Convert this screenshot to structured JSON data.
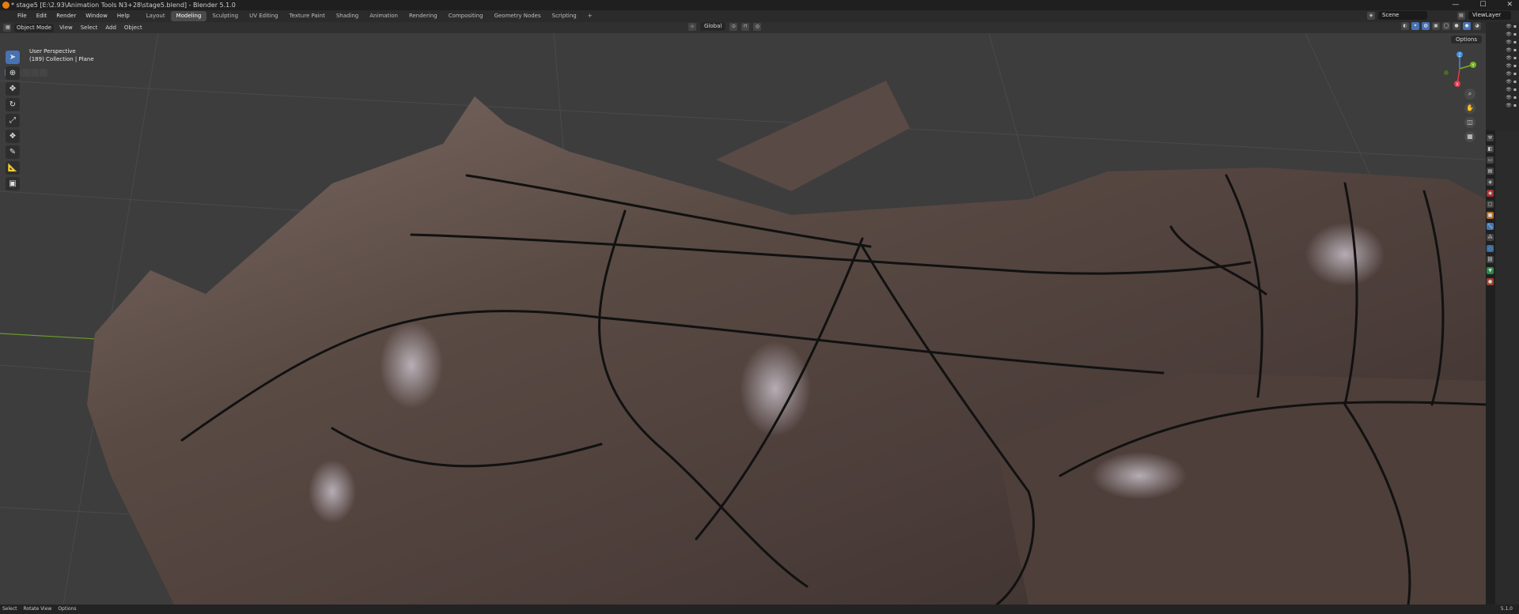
{
  "window": {
    "title": "* stage5 [E:\\2.93\\Animation Tools N3+28\\stage5.blend] - Blender 5.1.0",
    "minimize": "—",
    "maximize": "☐",
    "close": "✕"
  },
  "menu": [
    "File",
    "Edit",
    "Render",
    "Window",
    "Help"
  ],
  "workspaces": [
    "Layout",
    "Modeling",
    "Sculpting",
    "UV Editing",
    "Texture Paint",
    "Shading",
    "Animation",
    "Rendering",
    "Compositing",
    "Geometry Nodes",
    "Scripting"
  ],
  "active_workspace": "Modeling",
  "add_workspace": "+",
  "scene": {
    "name": "Scene",
    "view_layer": "ViewLayer"
  },
  "viewport_header": {
    "mode": "Object Mode",
    "menus": [
      "View",
      "Select",
      "Add",
      "Object"
    ],
    "transform_orientation": "Global",
    "options_label": "Options"
  },
  "overlay": {
    "perspective": "User Perspective",
    "collection": "(189) Collection | Plane"
  },
  "gizmo": {
    "x": "X",
    "y": "Y",
    "z": "Z"
  },
  "tools": [
    "select-box",
    "cursor",
    "move",
    "rotate",
    "scale",
    "transform",
    "annotate",
    "measure",
    "add-cube"
  ],
  "status": {
    "select": "Select",
    "rotate": "Rotate View",
    "options": "Options",
    "version": "5.1.0"
  },
  "colors": {
    "accent": "#4772b3",
    "x_axis": "#e5394b",
    "y_axis": "#77b023",
    "z_axis": "#3b8ee0",
    "logo": "#e87d0d"
  }
}
